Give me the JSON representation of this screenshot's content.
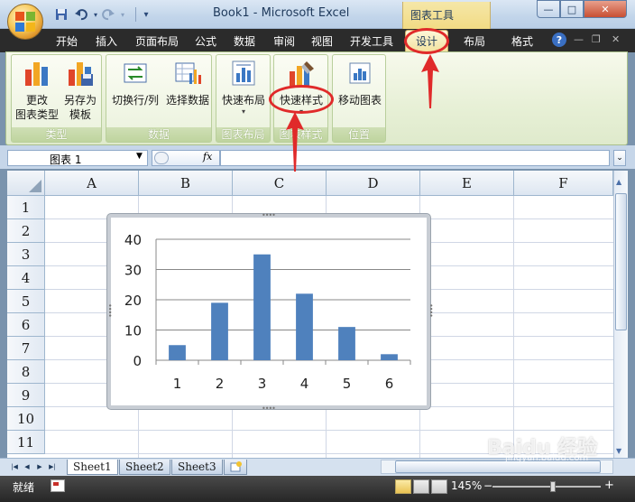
{
  "window": {
    "title": "Book1 - Microsoft Excel",
    "context_group": "图表工具",
    "buttons": {
      "minimize": "—",
      "maximize": "□",
      "close": "✕"
    }
  },
  "qat": {
    "icons": [
      "save-icon",
      "undo-icon",
      "redo-icon",
      "customize-icon"
    ]
  },
  "tabs": [
    {
      "label": "开始"
    },
    {
      "label": "插入"
    },
    {
      "label": "页面布局"
    },
    {
      "label": "公式"
    },
    {
      "label": "数据"
    },
    {
      "label": "审阅"
    },
    {
      "label": "视图"
    },
    {
      "label": "开发工具"
    },
    {
      "label": "设计",
      "active": true
    },
    {
      "label": "布局"
    },
    {
      "label": "格式"
    }
  ],
  "help_icon": "?",
  "ribbon": {
    "groups": [
      {
        "label": "类型",
        "buttons": [
          {
            "line1": "更改",
            "line2": "图表类型"
          },
          {
            "line1": "另存为",
            "line2": "模板"
          }
        ]
      },
      {
        "label": "数据",
        "buttons": [
          {
            "line1": "切换行/列"
          },
          {
            "line1": "选择数据"
          }
        ]
      },
      {
        "label": "图表布局",
        "buttons": [
          {
            "line1": "快速布局"
          }
        ]
      },
      {
        "label": "图表样式",
        "buttons": [
          {
            "line1": "快速样式"
          }
        ]
      },
      {
        "label": "位置",
        "buttons": [
          {
            "line1": "移动图表"
          }
        ]
      }
    ],
    "drop_caret": "▾"
  },
  "formula_bar": {
    "name_box": "图表 1",
    "fx": "fx",
    "value": ""
  },
  "columns": [
    "A",
    "B",
    "C",
    "D",
    "E",
    "F"
  ],
  "rows": [
    "1",
    "2",
    "3",
    "4",
    "5",
    "6",
    "7",
    "8",
    "9",
    "10",
    "11"
  ],
  "chart_data": {
    "type": "bar",
    "categories": [
      "1",
      "2",
      "3",
      "4",
      "5",
      "6"
    ],
    "values": [
      5,
      19,
      35,
      22,
      11,
      2
    ],
    "ylim": [
      0,
      40
    ],
    "yticks": [
      0,
      10,
      20,
      30,
      40
    ],
    "grid": true,
    "bar_color": "#4f81bd",
    "legend": "none"
  },
  "sheets": [
    "Sheet1",
    "Sheet2",
    "Sheet3"
  ],
  "status": {
    "ready": "就绪",
    "zoom": "145%"
  },
  "watermark": {
    "text": "Baidu 经验",
    "url": "jingyan.baidu.com"
  },
  "colors": {
    "annotation": "#e02a2a",
    "context_tab": "#f3e3a0",
    "ribbon": "#e7f0d6"
  }
}
